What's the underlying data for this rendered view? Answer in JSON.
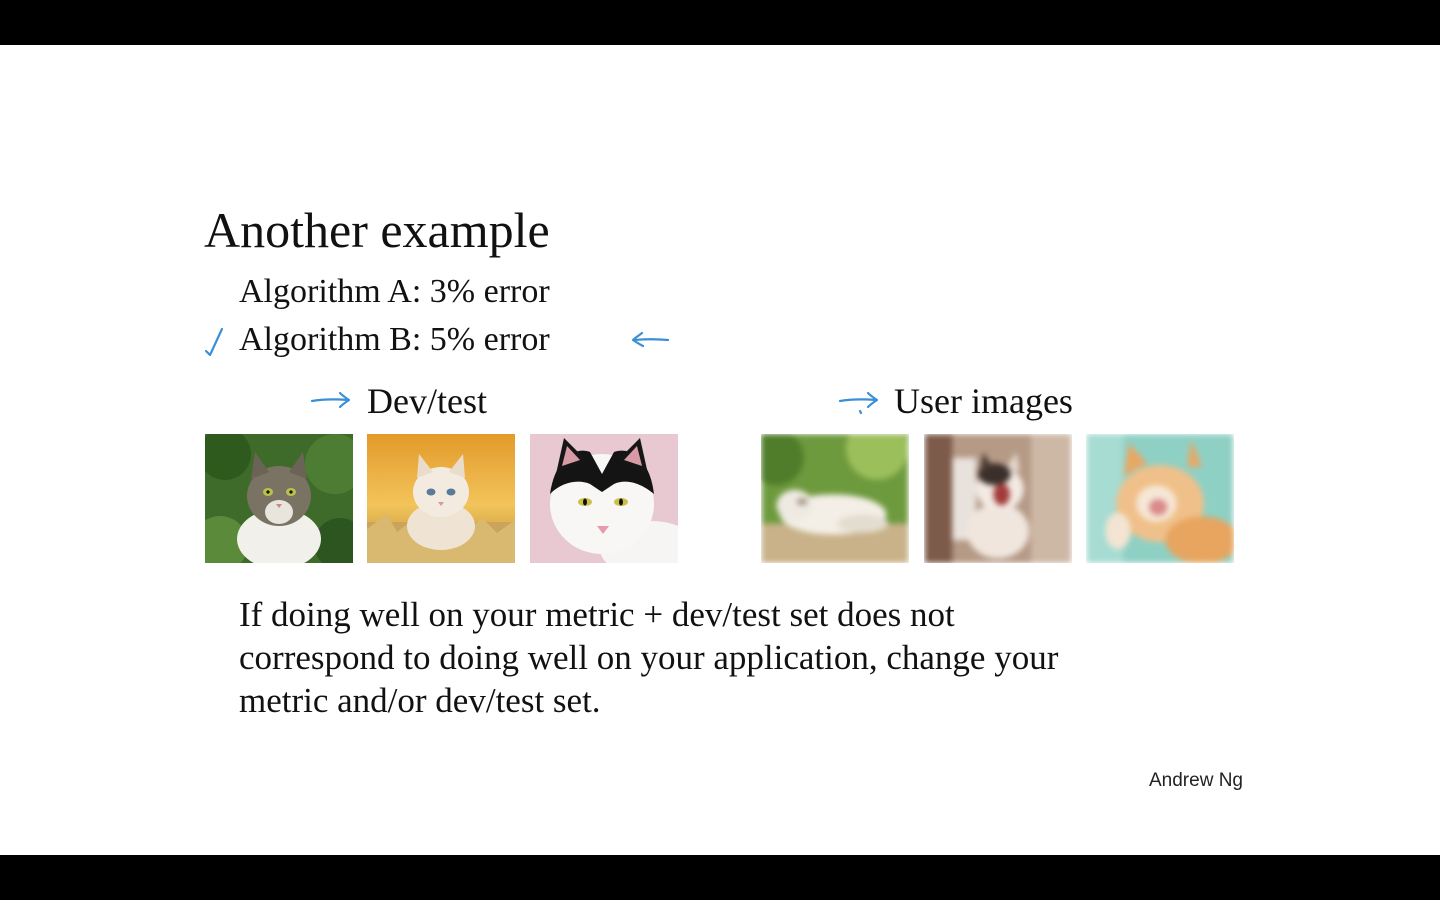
{
  "slide": {
    "title": "Another example",
    "algorithms": [
      {
        "label": "Algorithm A: 3% error"
      },
      {
        "label": "Algorithm B: 5% error"
      }
    ],
    "groups": {
      "dev_label": "Dev/test",
      "user_label": "User images"
    },
    "dev_images": [
      {
        "subject": "tabby cat in green foliage"
      },
      {
        "subject": "light kitten in straw"
      },
      {
        "subject": "black and white cat on pink background"
      }
    ],
    "user_images": [
      {
        "subject": "blurry white kitten lying"
      },
      {
        "subject": "blurry kitten yawning"
      },
      {
        "subject": "blurry orange cat grooming"
      }
    ],
    "body_lines": [
      "If doing well on your metric + dev/test set does not",
      "correspond to doing well on your application, change your",
      "metric and/or dev/test set."
    ],
    "author": "Andrew Ng",
    "ink_color": "#3a8fd8"
  }
}
